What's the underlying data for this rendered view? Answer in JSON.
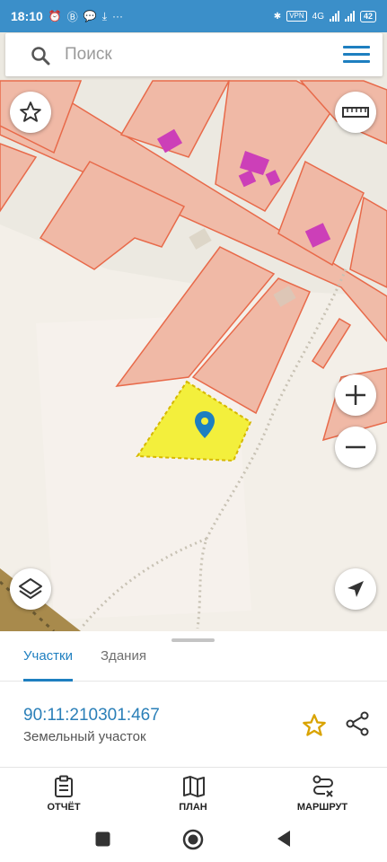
{
  "status_bar": {
    "time": "18:10",
    "vpn_label": "VPN",
    "network": "4G",
    "battery": "42"
  },
  "search": {
    "placeholder": "Поиск"
  },
  "map": {
    "selected_parcel_color": "#f3ef3c",
    "parcel_fill_color": "#f0b9a6",
    "parcel_border_color": "#e86a4a",
    "building_color": "#cc3fb8",
    "pin_color": "#1e7fc0"
  },
  "tabs": [
    {
      "label": "Участки",
      "active": true
    },
    {
      "label": "Здания",
      "active": false
    }
  ],
  "parcel": {
    "cadastral_number": "90:11:210301:467",
    "type": "Земельный участок"
  },
  "actions": [
    {
      "label": "ОТЧЁТ",
      "icon": "clipboard-icon"
    },
    {
      "label": "ПЛАН",
      "icon": "map-icon"
    },
    {
      "label": "МАРШРУТ",
      "icon": "route-icon"
    }
  ],
  "colors": {
    "accent": "#1e7fc0",
    "status_bar": "#3b8fc9",
    "favorite_star": "#d9a300"
  }
}
